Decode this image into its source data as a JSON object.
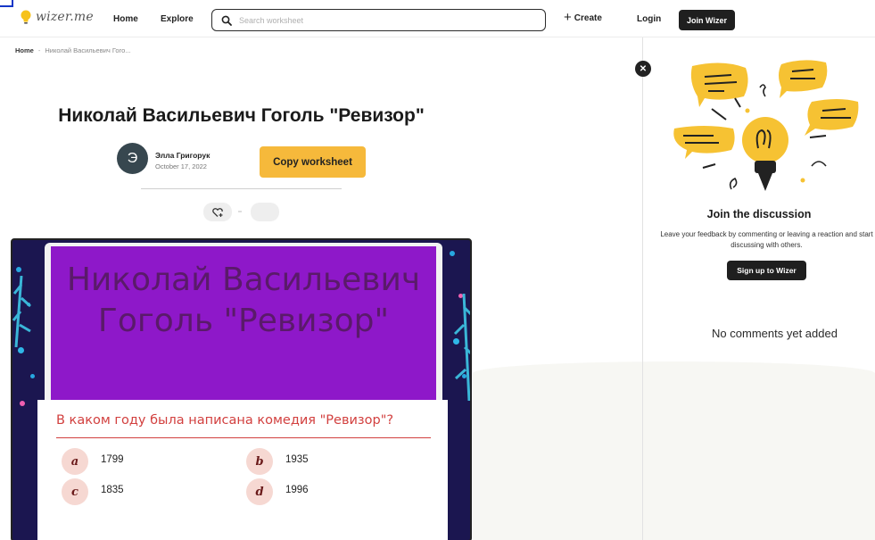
{
  "header": {
    "logo_text": "wizer.me",
    "nav": {
      "home": "Home",
      "explore": "Explore"
    },
    "search": {
      "placeholder": "Search worksheet",
      "value": ""
    },
    "create_label": "Create",
    "login_label": "Login",
    "join_label": "Join Wizer"
  },
  "breadcrumb": {
    "home": "Home",
    "separator": "-",
    "current": "Николай Васильевич Гого..."
  },
  "worksheet": {
    "title": "Николай Васильевич Гоголь \"Ревизор\"",
    "author": {
      "initial": "Э",
      "name": "Элла Григорук",
      "date": "October 17, 2022"
    },
    "copy_label": "Copy worksheet"
  },
  "preview": {
    "title": "Николай Васильевич Гоголь \"Ревизор\"",
    "question": "В каком году была написана комедия \"Ревизор\"?",
    "options": [
      {
        "letter": "a",
        "value": "1799"
      },
      {
        "letter": "b",
        "value": "1935"
      },
      {
        "letter": "c",
        "value": "1835"
      },
      {
        "letter": "d",
        "value": "1996"
      }
    ]
  },
  "discussion": {
    "heading": "Join the discussion",
    "description": "Leave your feedback by commenting or leaving a reaction and start discussing with others.",
    "signup_label": "Sign up to Wizer",
    "empty_text": "No comments yet added"
  },
  "colors": {
    "accent_yellow": "#f6b93b",
    "dark_button": "#1f1f1f",
    "sheet_purple": "#8e18c9",
    "question_red": "#d2403f"
  },
  "icons": [
    "lightbulb-logo-icon",
    "search-icon",
    "plus-icon",
    "heart-plus-icon",
    "close-icon"
  ]
}
